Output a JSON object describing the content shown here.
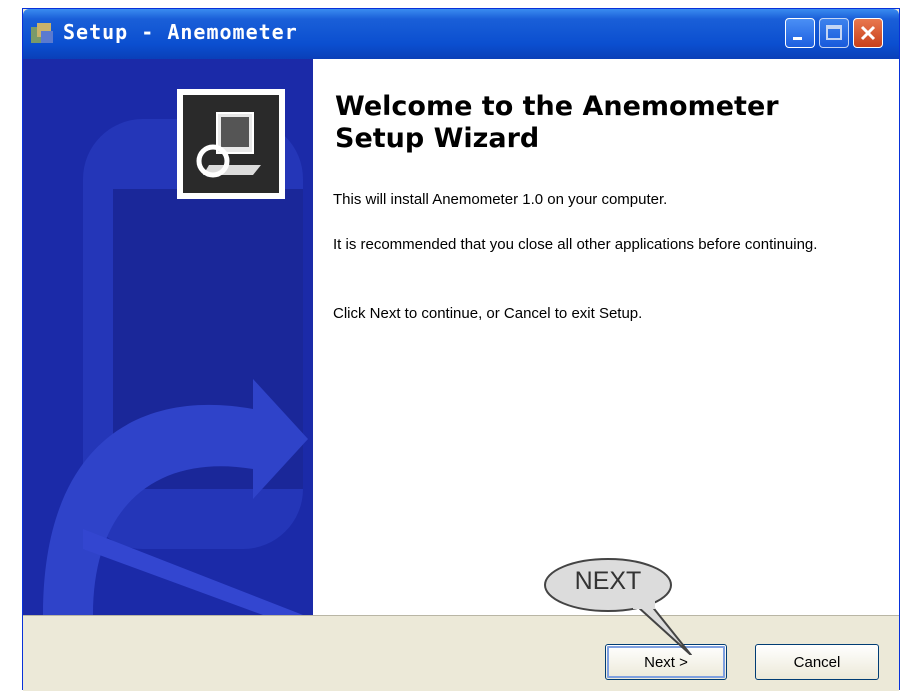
{
  "window": {
    "title": "Setup - Anemometer",
    "title_color": "#ffffff",
    "titlebar_color": "#0b4fd0"
  },
  "banner": {
    "color": "#1b2aa8"
  },
  "main": {
    "heading": "Welcome to the Anemometer Setup Wizard",
    "p1": "This will install Anemometer 1.0 on your computer.",
    "p2": "It is recommended that you close all other applications before continuing.",
    "p3": "Click Next to continue, or Cancel to exit Setup."
  },
  "buttons": {
    "next_label": "Next >",
    "cancel_label": "Cancel"
  },
  "callout": {
    "text": "NEXT"
  }
}
